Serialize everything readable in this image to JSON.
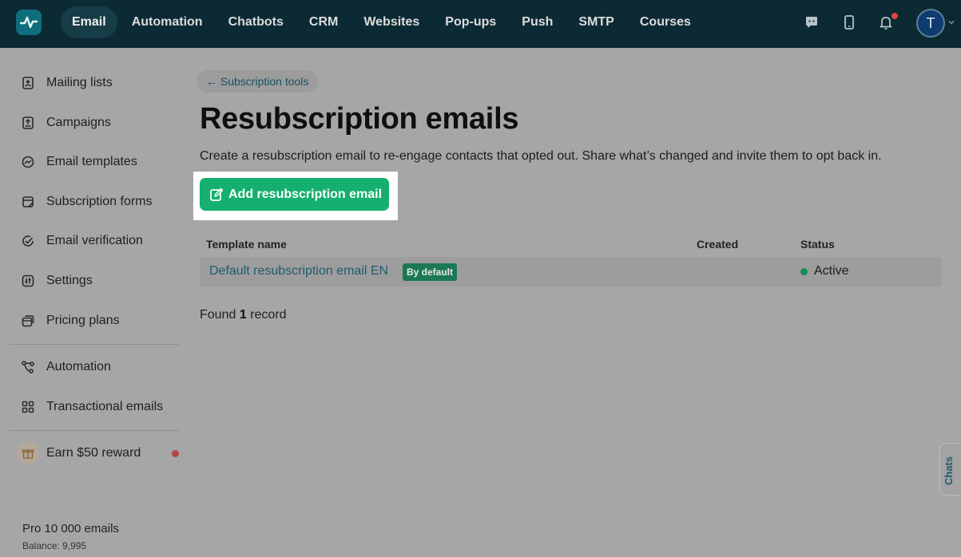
{
  "topnav": {
    "items": [
      "Email",
      "Automation",
      "Chatbots",
      "CRM",
      "Websites",
      "Pop-ups",
      "Push",
      "SMTP",
      "Courses"
    ],
    "active": "Email",
    "icons": [
      "chat-icon",
      "mobile-icon",
      "bell-icon"
    ],
    "avatar_initial": "T"
  },
  "sidebar": {
    "items": [
      {
        "label": "Mailing lists",
        "icon": "contacts-book-icon"
      },
      {
        "label": "Campaigns",
        "icon": "upload-tray-icon"
      },
      {
        "label": "Email templates",
        "icon": "template-icon"
      },
      {
        "label": "Subscription forms",
        "icon": "form-icon"
      },
      {
        "label": "Email verification",
        "icon": "check-circle-icon"
      },
      {
        "label": "Settings",
        "icon": "sliders-icon"
      },
      {
        "label": "Pricing plans",
        "icon": "cards-icon"
      },
      {
        "label": "Automation",
        "icon": "flow-icon"
      },
      {
        "label": "Transactional emails",
        "icon": "grid-icon"
      }
    ],
    "earn_label": "Earn $50 reward",
    "plan_name": "Pro 10 000 emails",
    "balance": "Balance: 9,995"
  },
  "main": {
    "breadcrumb": "← Subscription tools",
    "title": "Resubscription emails",
    "description": "Create a resubscription email to re-engage contacts that opted out. Share what’s changed and invite them to opt back in.",
    "add_button": "Add resubscription email",
    "table": {
      "headers": [
        "Template name",
        "Created",
        "Status"
      ],
      "rows": [
        {
          "name": "Default resubscription email EN",
          "badge": "By default",
          "created": "",
          "status": "Active"
        }
      ]
    },
    "found_prefix": "Found",
    "found_count": "1",
    "found_suffix": "record"
  },
  "chats_tab": "Chats",
  "colors": {
    "topbar": "#0b2a33",
    "primary_button": "#15b070",
    "link": "#1f5b6e",
    "badge": "#1b7a55",
    "notification": "#d44444"
  }
}
